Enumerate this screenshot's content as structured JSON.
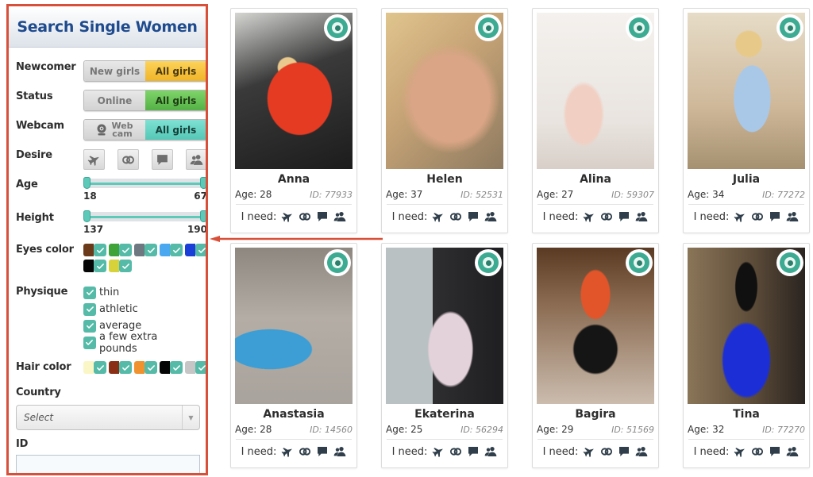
{
  "sidebar": {
    "title": "Search Single Women",
    "newcomer": {
      "label": "Newcomer",
      "option_off": "New girls",
      "option_on": "All girls"
    },
    "status": {
      "label": "Status",
      "option_off": "Online",
      "option_on": "All girls"
    },
    "webcam": {
      "label": "Webcam",
      "option_off_line1": "Web",
      "option_off_line2": "cam",
      "option_on": "All girls",
      "icon": "webcam-icon"
    },
    "desire": {
      "label": "Desire",
      "icons": [
        "plane-icon",
        "rings-icon",
        "chat-bubble-icon",
        "users-icon"
      ]
    },
    "age": {
      "label": "Age",
      "min": "18",
      "max": "67",
      "low_fraction": 0.0,
      "high_fraction": 1.0
    },
    "height": {
      "label": "Height",
      "min": "137",
      "max": "190",
      "low_fraction": 0.0,
      "high_fraction": 1.0
    },
    "eyes_color": {
      "label": "Eyes color",
      "colors": [
        "#6b3a1a",
        "#3fa33a",
        "#6d7880",
        "#4aa8f0",
        "#1a3fd8",
        "#050505",
        "#d8d23a"
      ],
      "checked": true
    },
    "physique": {
      "label": "Physique",
      "options": [
        "thin",
        "athletic",
        "average",
        "a few extra pounds"
      ],
      "checked": true
    },
    "hair_color": {
      "label": "Hair color",
      "colors": [
        "#fbf6c6",
        "#8a2e16",
        "#f0922e",
        "#050505",
        "#c6c6c6"
      ],
      "checked": true
    },
    "country": {
      "label": "Country",
      "placeholder": "Select"
    },
    "id": {
      "label": "ID",
      "value": ""
    }
  },
  "cards_common": {
    "need_label": "I need:",
    "need_icons": [
      "plane-icon",
      "rings-icon",
      "chat-bubble-icon",
      "users-icon"
    ],
    "badge_icon": "webcam-icon"
  },
  "cards": [
    {
      "name": "Anna",
      "age": "Age: 28",
      "id": "ID: 77933"
    },
    {
      "name": "Helen",
      "age": "Age: 37",
      "id": "ID: 52531"
    },
    {
      "name": "Alina",
      "age": "Age: 27",
      "id": "ID: 59307"
    },
    {
      "name": "Julia",
      "age": "Age: 34",
      "id": "ID: 77272"
    },
    {
      "name": "Anastasia",
      "age": "Age: 28",
      "id": "ID: 14560"
    },
    {
      "name": "Ekaterina",
      "age": "Age: 25",
      "id": "ID: 56294"
    },
    {
      "name": "Bagira",
      "age": "Age: 29",
      "id": "ID: 51569"
    },
    {
      "name": "Tina",
      "age": "Age: 32",
      "id": "ID: 77270"
    }
  ],
  "colors": {
    "accent_teal": "#55bba8",
    "highlight_border": "#d9503a",
    "title_blue": "#1f4b8e"
  }
}
